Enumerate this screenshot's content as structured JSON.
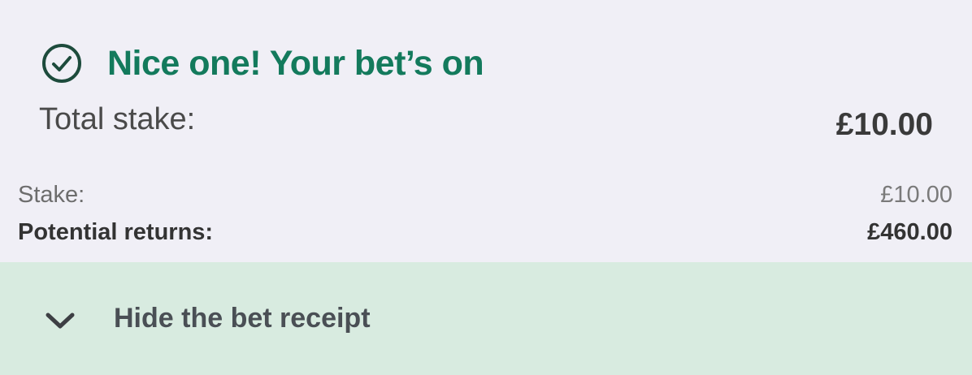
{
  "confirmation": {
    "icon": "check-circle-icon",
    "title": "Nice one! Your bet’s on",
    "accent_color": "#137a5c"
  },
  "summary": {
    "total_stake_label": "Total stake:",
    "total_stake_value": "£10.00",
    "stake_label": "Stake:",
    "stake_value": "£10.00",
    "returns_label": "Potential returns:",
    "returns_value": "£460.00"
  },
  "receipt_toggle": {
    "icon": "chevron-down-icon",
    "label": "Hide the bet receipt",
    "background_color": "#d8ebe0"
  }
}
